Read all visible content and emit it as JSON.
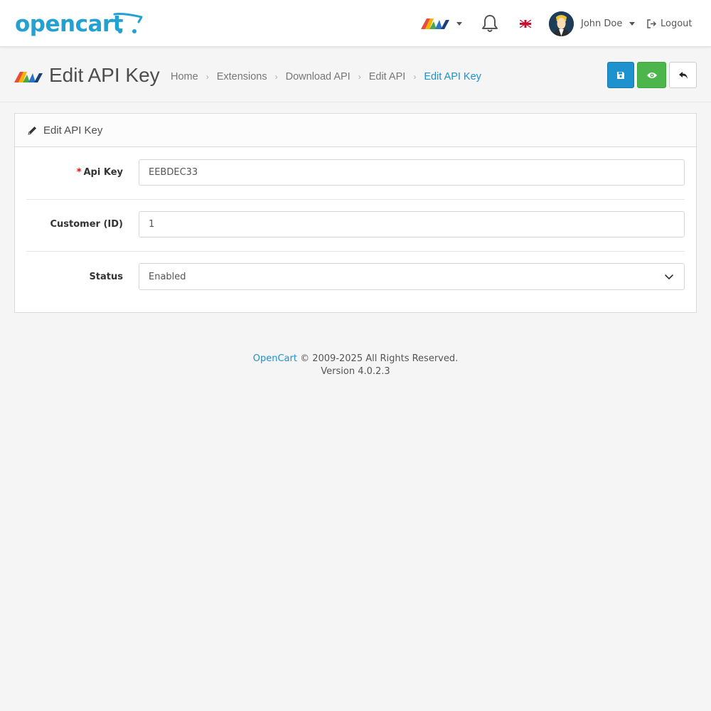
{
  "header": {
    "logo_text": "opencart",
    "user_name": "John Doe",
    "logout_label": "Logout"
  },
  "page": {
    "title": "Edit API Key",
    "breadcrumb": [
      "Home",
      "Extensions",
      "Download API",
      "Edit API",
      "Edit API Key"
    ]
  },
  "actions": {
    "save_color": "#1e91cf",
    "view_color": "#4cb64c"
  },
  "card": {
    "title": "Edit API Key",
    "fields": {
      "api_key": {
        "label": "Api Key",
        "value": "EEBDEC33",
        "required": true
      },
      "customer_id": {
        "label": "Customer (ID)",
        "value": "1"
      },
      "status": {
        "label": "Status",
        "value": "Enabled"
      }
    }
  },
  "footer": {
    "link": "OpenCart",
    "copyright": " © 2009-2025 All Rights Reserved.",
    "version": "Version 4.0.2.3"
  },
  "colors": {
    "brand": "#23a1d1",
    "link": "#1e91cf"
  }
}
